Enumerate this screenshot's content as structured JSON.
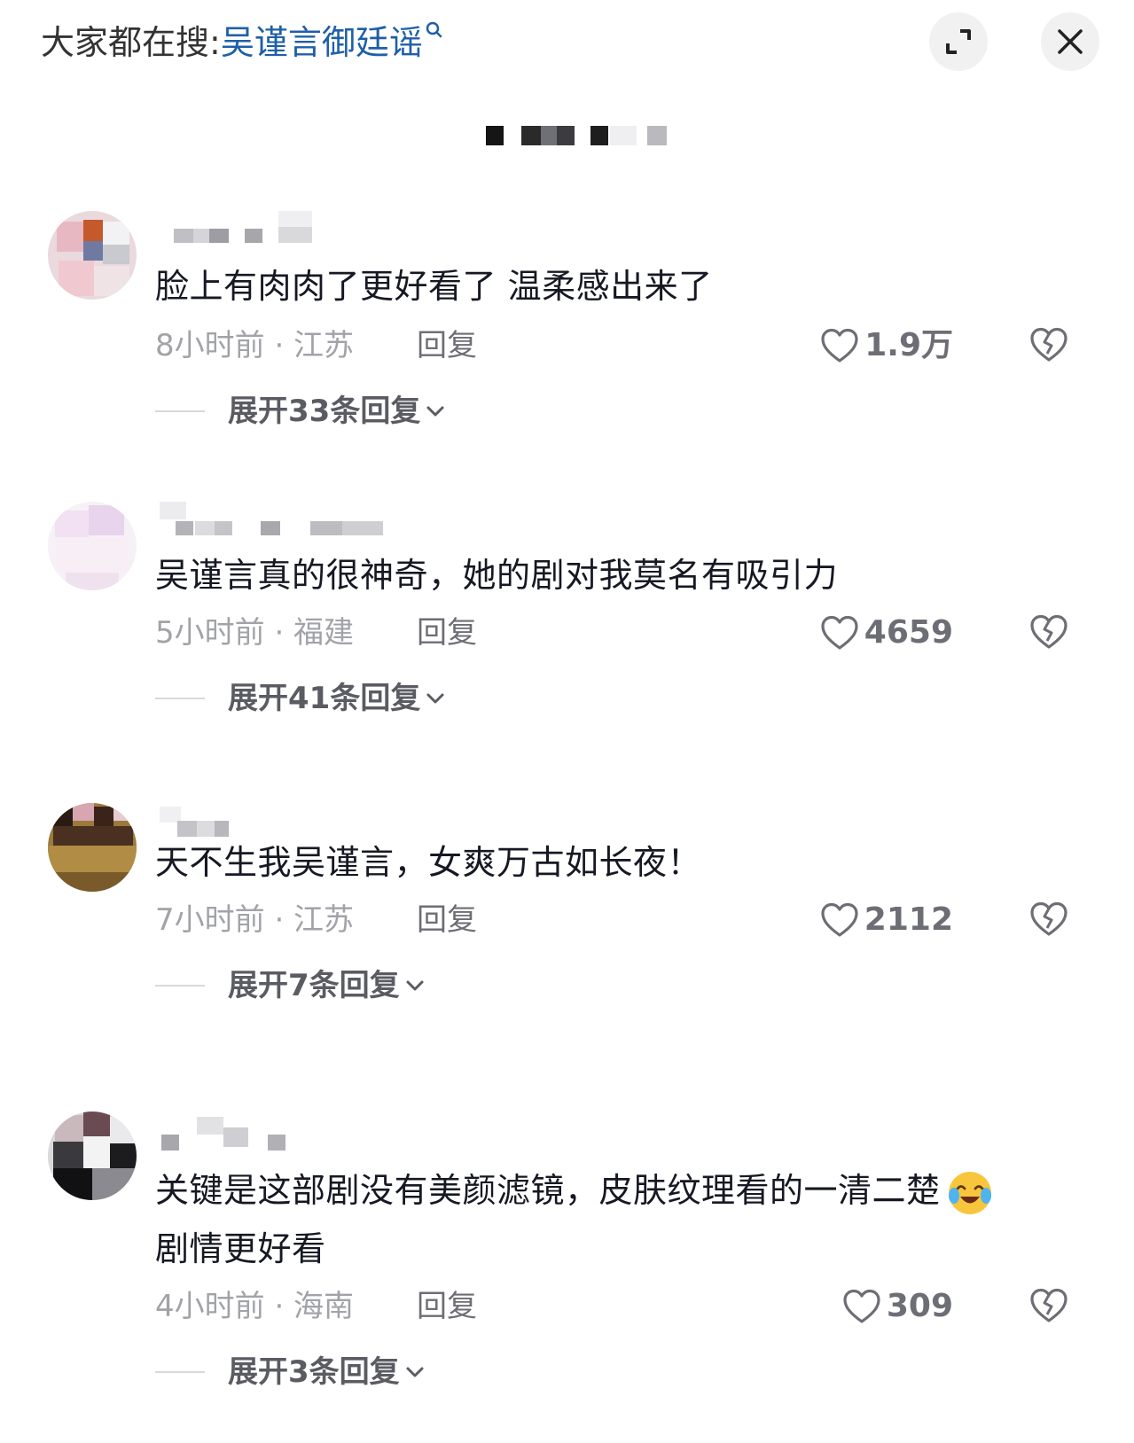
{
  "search": {
    "prefix": "大家都在搜:",
    "keyword": "吴谨言御廷谣"
  },
  "colors": {
    "accent": "#1f5fa8",
    "text": "#161823",
    "muted": "#a2a3a8"
  },
  "icons": {
    "expand": "expand-icon",
    "close": "close-icon",
    "like": "heart-outline-icon",
    "dislike": "broken-heart-icon",
    "chevron": "chevron-down-icon",
    "search": "search-icon"
  },
  "comments": [
    {
      "text": "脸上有肉肉了更好看了 温柔感出来了",
      "time_location": "8小时前 · 江苏",
      "reply_label": "回复",
      "likes": "1.9万",
      "expand_label": "展开33条回复"
    },
    {
      "text": "吴谨言真的很神奇，她的剧对我莫名有吸引力",
      "time_location": "5小时前 · 福建",
      "reply_label": "回复",
      "likes": "4659",
      "expand_label": "展开41条回复"
    },
    {
      "text": "天不生我吴谨言，女爽万古如长夜！",
      "time_location": "7小时前 · 江苏",
      "reply_label": "回复",
      "likes": "2112",
      "expand_label": "展开7条回复"
    },
    {
      "text": "关键是这部剧没有美颜滤镜，皮肤纹理看的一清二楚",
      "text2": "剧情更好看",
      "time_location": "4小时前 · 海南",
      "reply_label": "回复",
      "likes": "309",
      "expand_label": "展开3条回复"
    }
  ]
}
